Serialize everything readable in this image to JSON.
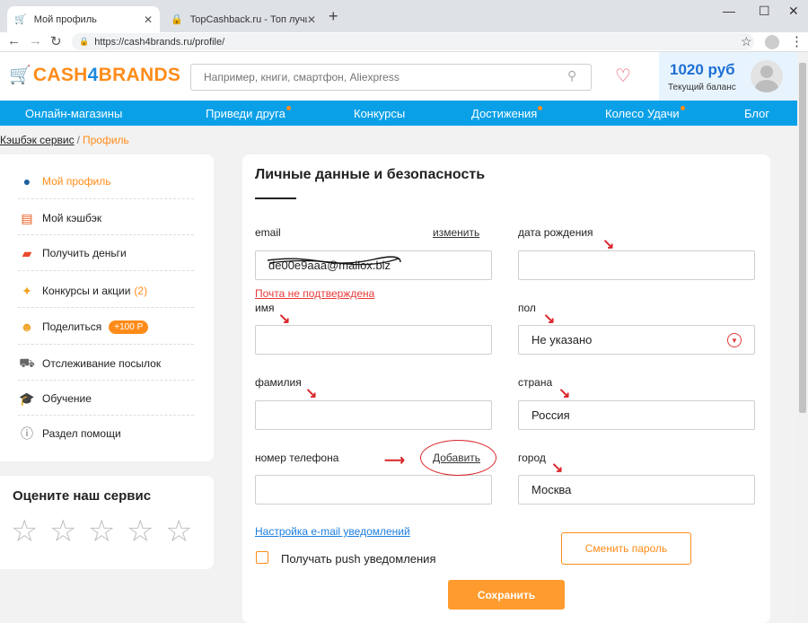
{
  "browser": {
    "tabs": [
      {
        "title": "Мой профиль",
        "favicon": "cart-icon",
        "active": true
      },
      {
        "title": "TopCashback.ru - Топ лучших кэ",
        "favicon": "lock-icon",
        "active": false
      }
    ],
    "url": "https://cash4brands.ru/profile/"
  },
  "header": {
    "logo_part1": "CASH",
    "logo_part2": "4",
    "logo_part3": "BRANDS",
    "search_placeholder": "Например, книги, смартфон, Aliexpress",
    "balance_amount": "1020 руб",
    "balance_label": "Текущий баланс"
  },
  "nav": [
    "Онлайн-магазины",
    "Приведи друга",
    "Конкурсы",
    "Достижения",
    "Колесо Удачи",
    "Блог"
  ],
  "breadcrumb": {
    "root": "Кэшбэк сервис",
    "separator": "/",
    "current": "Профиль"
  },
  "sidebar": {
    "items": [
      {
        "label": "Мой профиль",
        "icon": "user-icon"
      },
      {
        "label": "Мой кэшбэк",
        "icon": "receipt-icon"
      },
      {
        "label": "Получить деньги",
        "icon": "wallet-icon"
      },
      {
        "label": "Конкурсы и акции",
        "count": "(2)",
        "icon": "party-icon"
      },
      {
        "label": "Поделиться",
        "badge": "+100 Р",
        "icon": "share-icon"
      },
      {
        "label": "Отслеживание посылок",
        "icon": "truck-icon"
      },
      {
        "label": "Обучение",
        "icon": "graduation-cap-icon"
      },
      {
        "label": "Раздел помощи",
        "icon": "help-icon"
      }
    ],
    "rate_title": "Оцените наш сервис"
  },
  "profile": {
    "title": "Личные данные и безопасность",
    "email_label": "email",
    "email_change": "изменить",
    "email_value": "de00e9aaa@mailox.biz",
    "email_warning": "Почта не подтверждена",
    "birth_label": "дата рождения",
    "birth_value": "",
    "name_label": "имя",
    "gender_label": "пол",
    "gender_value": "Не указано",
    "surname_label": "фамилия",
    "country_label": "страна",
    "country_value": "Россия",
    "phone_label": "номер телефона",
    "phone_add": "Добавить",
    "city_label": "город",
    "city_value": "Москва",
    "notif_link": "Настройка e-mail уведомлений",
    "push_label": "Получать push уведомления",
    "push_checked": false,
    "change_password": "Сменить пароль",
    "save": "Сохранить"
  },
  "colors": {
    "accent": "#ff8c1a",
    "nav": "#0aa0e8",
    "brand_blue": "#1d8ae0",
    "annotation": "#d9262a"
  }
}
